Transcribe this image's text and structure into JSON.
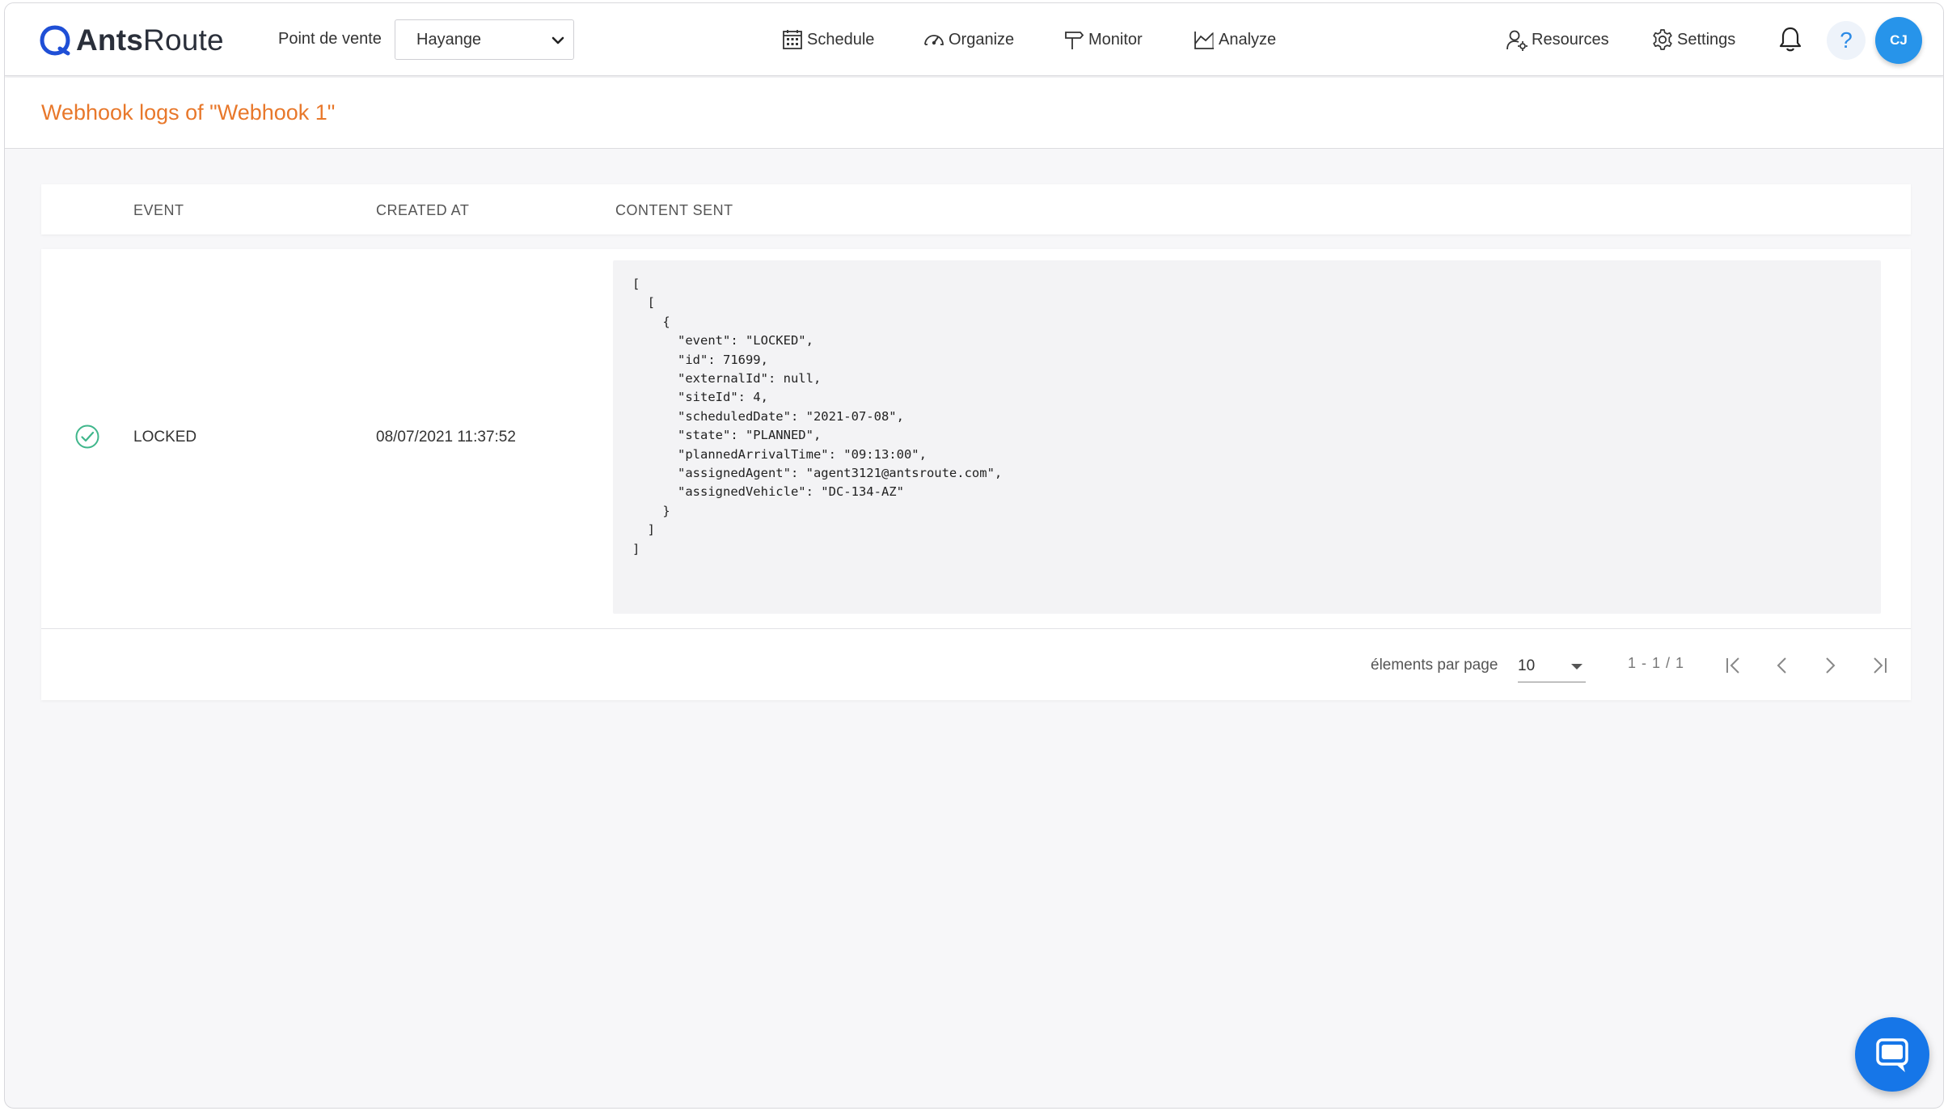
{
  "app": {
    "logo_bold": "Ants",
    "logo_light": "Route"
  },
  "header": {
    "pos_label": "Point de vente",
    "pos_selected": "Hayange",
    "nav": [
      {
        "label": "Schedule",
        "icon": "calendar-icon"
      },
      {
        "label": "Organize",
        "icon": "gauge-icon"
      },
      {
        "label": "Monitor",
        "icon": "signpost-icon"
      },
      {
        "label": "Analyze",
        "icon": "chart-icon"
      }
    ],
    "resources_label": "Resources",
    "settings_label": "Settings",
    "help_label": "?",
    "avatar_initials": "CJ"
  },
  "page": {
    "title": "Webhook logs of \"Webhook 1\""
  },
  "table": {
    "columns": [
      "EVENT",
      "CREATED AT",
      "CONTENT SENT"
    ],
    "rows": [
      {
        "status": "success",
        "event": "LOCKED",
        "created_at": "08/07/2021 11:37:52",
        "content": "[\n  [\n    {\n      \"event\": \"LOCKED\",\n      \"id\": 71699,\n      \"externalId\": null,\n      \"siteId\": 4,\n      \"scheduledDate\": \"2021-07-08\",\n      \"state\": \"PLANNED\",\n      \"plannedArrivalTime\": \"09:13:00\",\n      \"assignedAgent\": \"agent3121@antsroute.com\",\n      \"assignedVehicle\": \"DC-134-AZ\"\n    }\n  ]\n]"
      }
    ]
  },
  "pagination": {
    "per_page_label": "élements par page",
    "per_page_value": "10",
    "range": "1 - 1 / 1"
  },
  "colors": {
    "accent_orange": "#e8782b",
    "primary_blue": "#2794ea",
    "success_green": "#3fb68b"
  }
}
